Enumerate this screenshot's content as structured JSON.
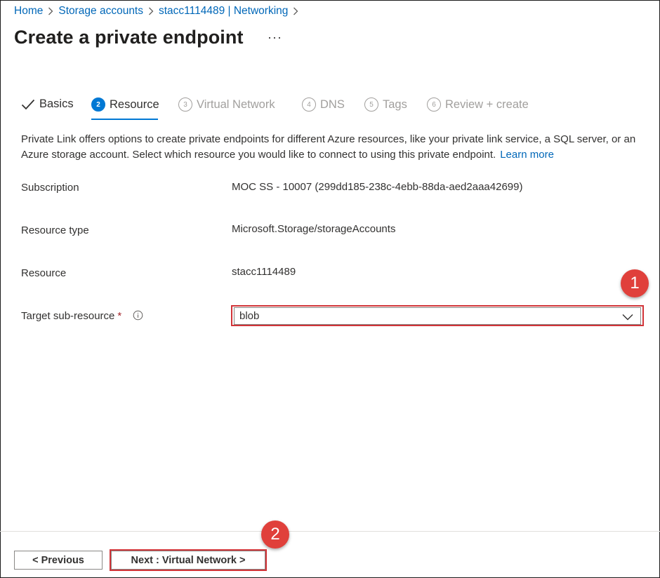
{
  "breadcrumb": [
    {
      "label": "Home"
    },
    {
      "label": "Storage accounts"
    },
    {
      "label": "stacc1114489 | Networking"
    }
  ],
  "page_title": "Create a private endpoint",
  "more_label": "···",
  "tabs": [
    {
      "label": "Basics",
      "state": "done"
    },
    {
      "num": "2",
      "label": "Resource",
      "state": "active"
    },
    {
      "num": "3",
      "label": "Virtual Network",
      "state": "disabled"
    },
    {
      "num": "4",
      "label": "DNS",
      "state": "disabled"
    },
    {
      "num": "5",
      "label": "Tags",
      "state": "disabled"
    },
    {
      "num": "6",
      "label": "Review + create",
      "state": "disabled"
    }
  ],
  "description": "Private Link offers options to create private endpoints for different Azure resources, like your private link service, a SQL server, or an Azure storage account. Select which resource you would like to connect to using this private endpoint.",
  "learn_more": "Learn more",
  "fields": {
    "subscription": {
      "label": "Subscription",
      "value": "MOC SS - 10007 (299dd185-238c-4ebb-88da-aed2aaa42699)"
    },
    "resource_type": {
      "label": "Resource type",
      "value": "Microsoft.Storage/storageAccounts"
    },
    "resource": {
      "label": "Resource",
      "value": "stacc1114489"
    },
    "target_sub_resource": {
      "label": "Target sub-resource",
      "required_mark": "*",
      "value": "blob"
    }
  },
  "annotations": {
    "one": "1",
    "two": "2"
  },
  "footer": {
    "previous_label": "< Previous",
    "next_label": "Next : Virtual Network >"
  },
  "colors": {
    "accent": "#0078d4",
    "link": "#0067b8",
    "highlight": "#d13438",
    "badge": "#e0403b"
  }
}
